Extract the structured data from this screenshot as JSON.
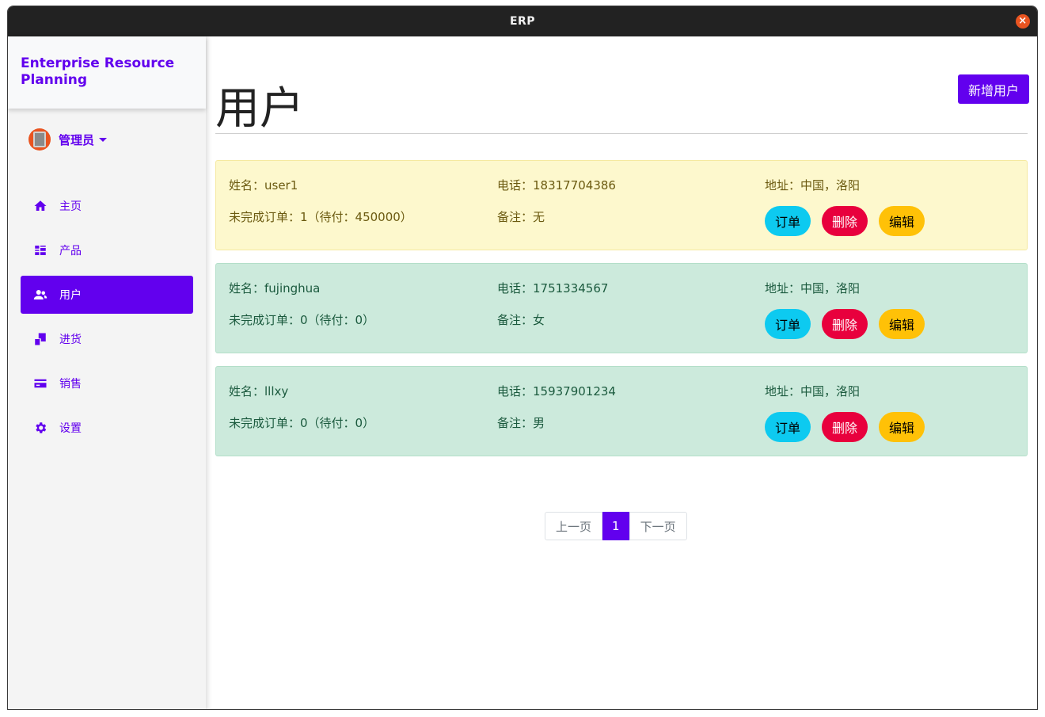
{
  "window": {
    "title": "ERP"
  },
  "sidebar": {
    "brand": "Enterprise Resource Planning",
    "user": "管理员",
    "items": [
      {
        "label": "主页",
        "icon": "home-icon"
      },
      {
        "label": "产品",
        "icon": "products-icon"
      },
      {
        "label": "用户",
        "icon": "users-icon",
        "active": true
      },
      {
        "label": "进货",
        "icon": "purchase-icon"
      },
      {
        "label": "销售",
        "icon": "sales-card-icon"
      },
      {
        "label": "设置",
        "icon": "gear-icon"
      }
    ]
  },
  "main": {
    "title": "用户",
    "add_button": "新增用户",
    "users": [
      {
        "name": "姓名：user1",
        "phone": "电话：18317704386",
        "address": "地址：中国，洛阳",
        "orders": "未完成订单：1（待付：450000）",
        "note": "备注：无",
        "status": "warning"
      },
      {
        "name": "姓名：fujinghua",
        "phone": "电话：1751334567",
        "address": "地址：中国，洛阳",
        "orders": "未完成订单：0（待付：0）",
        "note": "备注：女",
        "status": "success"
      },
      {
        "name": "姓名：lllxy",
        "phone": "电话：15937901234",
        "address": "地址：中国，洛阳",
        "orders": "未完成订单：0（待付：0）",
        "note": "备注：男",
        "status": "success"
      }
    ],
    "actions": {
      "orders": "订单",
      "delete": "删除",
      "edit": "编辑"
    },
    "pagination": {
      "prev": "上一页",
      "current": "1",
      "next": "下一页"
    }
  },
  "colors": {
    "accent": "#6200ee",
    "warning_card": "#fdf8cd",
    "success_card": "#cceadc",
    "info_button": "#0dcaf0",
    "danger_button": "#e8003d",
    "warning_button": "#ffc107"
  }
}
